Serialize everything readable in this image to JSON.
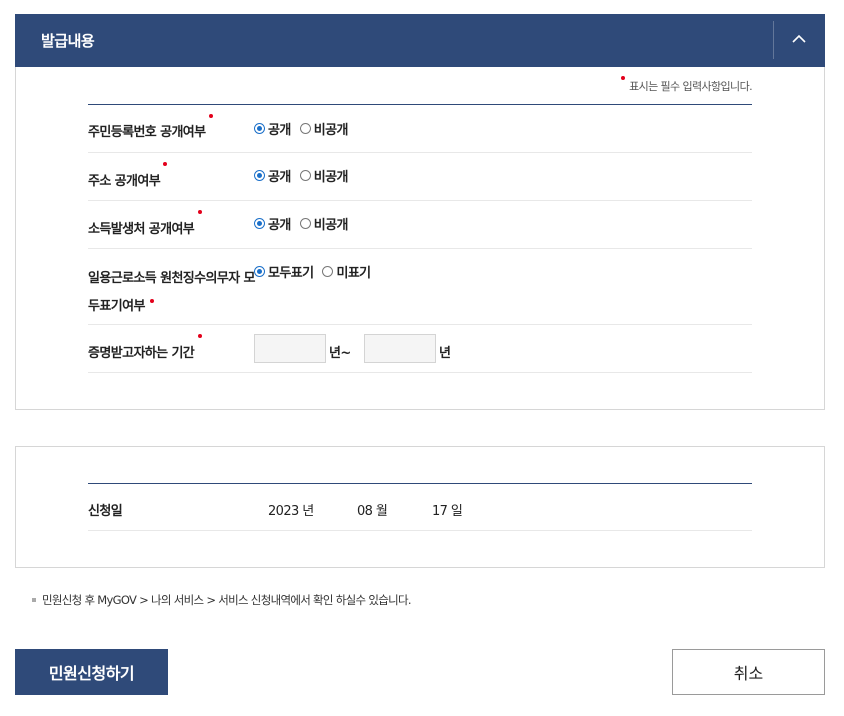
{
  "section_title": "발급내용",
  "required_note": "표시는 필수 입력사항입니다.",
  "colors": {
    "primary": "#2f4a79",
    "required_dot": "#e3001b",
    "radio_selected": "#1a6fc9"
  },
  "icons": {
    "collapse": "chevron-up-icon",
    "required": "required-dot"
  },
  "rows": [
    {
      "label": "주민등록번호 공개여부",
      "options": [
        "공개",
        "비공개"
      ],
      "selected": "공개"
    },
    {
      "label": "주소 공개여부",
      "options": [
        "공개",
        "비공개"
      ],
      "selected": "공개"
    },
    {
      "label": "소득발생처 공개여부",
      "options": [
        "공개",
        "비공개"
      ],
      "selected": "공개"
    },
    {
      "label_line1": "일용근로소득 원천징수의무자 모",
      "label_line2": "두표기여부",
      "options": [
        "모두표기",
        "미표기"
      ],
      "selected": "모두표기"
    },
    {
      "label": "증명받고자하는 기간",
      "from_value": "",
      "from_unit": "년~",
      "to_value": "",
      "to_unit": "년"
    }
  ],
  "application": {
    "label": "신청일",
    "year": "2023 년",
    "month": "08 월",
    "day": "17 일"
  },
  "notice": "민원신청 후 MyGOV > 나의 서비스 > 서비스 신청내역에서 확인 하실수 있습니다.",
  "buttons": {
    "submit": "민원신청하기",
    "cancel": "취소"
  }
}
